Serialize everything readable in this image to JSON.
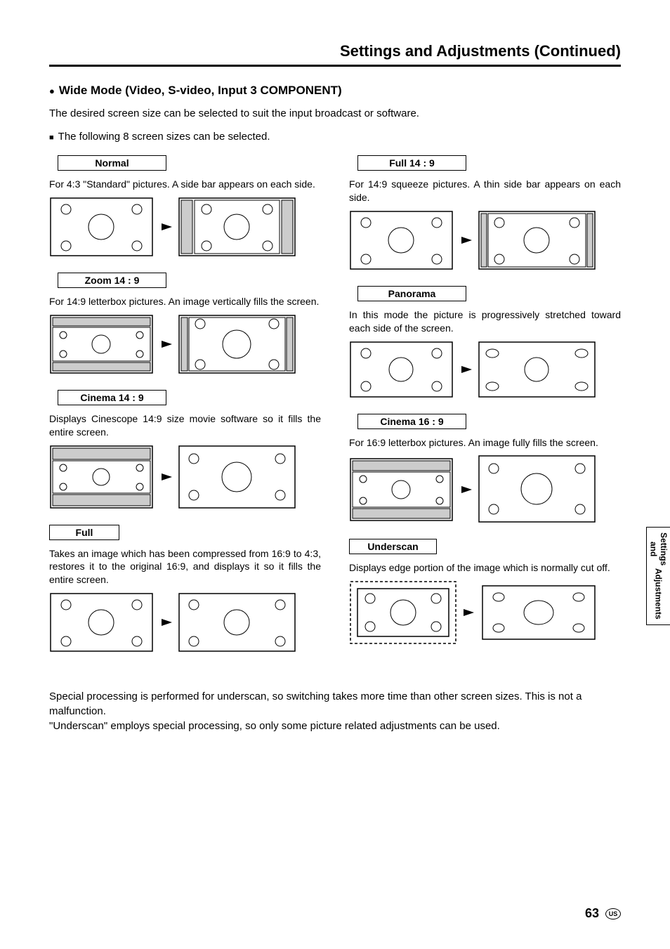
{
  "header": {
    "title": "Settings and Adjustments (Continued)"
  },
  "section": {
    "title": "Wide Mode (Video, S-video, Input 3 COMPONENT)",
    "intro1": "The desired screen size can be selected to suit the input broadcast or software.",
    "intro2": "The following 8 screen sizes can be selected."
  },
  "modes": {
    "left": [
      {
        "label": "Normal",
        "desc": "For 4:3 \"Standard\" pictures. A side bar appears on each side."
      },
      {
        "label": "Zoom 14 : 9",
        "desc": "For 14:9 letterbox pictures. An image vertically fills the screen."
      },
      {
        "label": "Cinema 14 : 9",
        "desc": "Displays Cinescope 14:9 size movie software so it fills the entire screen."
      },
      {
        "label": "Full",
        "desc": "Takes an image which has been compressed from 16:9 to 4:3, restores it to the original 16:9, and displays it so it fills the entire screen."
      }
    ],
    "right": [
      {
        "label": "Full 14 : 9",
        "desc": "For 14:9 squeeze pictures. A thin side bar appears on each side."
      },
      {
        "label": "Panorama",
        "desc": "In this mode the picture is progressively stretched toward each side of the screen."
      },
      {
        "label": "Cinema 16 : 9",
        "desc": "For 16:9 letterbox pictures. An image fully fills the screen."
      },
      {
        "label": "Underscan",
        "desc": "Displays edge portion of the image which is normally cut off."
      }
    ]
  },
  "notes": {
    "line1": "Special processing is performed for underscan, so switching takes more time than other screen sizes. This is not a malfunction.",
    "line2": "\"Underscan\" employs special processing, so only some picture related adjustments can be used."
  },
  "sidetab": {
    "line1": "Settings and",
    "line2": "Adjustments"
  },
  "footer": {
    "page": "63",
    "badge": "US"
  }
}
